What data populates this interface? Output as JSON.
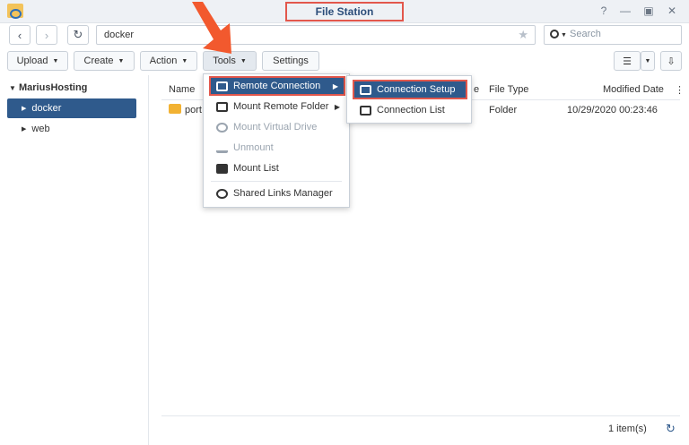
{
  "window": {
    "title": "File Station",
    "help_icon": "question-icon",
    "minimize_icon": "minimize-icon",
    "maximize_icon": "maximize-icon",
    "close_icon": "close-icon"
  },
  "nav": {
    "path": "docker",
    "search_placeholder": "Search"
  },
  "toolbar": {
    "upload": "Upload",
    "create": "Create",
    "action": "Action",
    "tools": "Tools",
    "settings": "Settings"
  },
  "tree": {
    "root": "MariusHosting",
    "items": [
      {
        "label": "docker"
      },
      {
        "label": "web"
      }
    ]
  },
  "table": {
    "headers": {
      "name": "Name",
      "size": "e",
      "type": "File Type",
      "modified": "Modified Date"
    },
    "rows": [
      {
        "name": "port",
        "type": "Folder",
        "modified": "10/29/2020 00:23:46"
      }
    ]
  },
  "status": {
    "count": "1 item(s)"
  },
  "tools_menu": {
    "items": [
      {
        "label": "Remote Connection"
      },
      {
        "label": "Mount Remote Folder"
      },
      {
        "label": "Mount Virtual Drive"
      },
      {
        "label": "Unmount"
      },
      {
        "label": "Mount List"
      },
      {
        "label": "Shared Links Manager"
      }
    ]
  },
  "submenu": {
    "items": [
      {
        "label": "Connection Setup"
      },
      {
        "label": "Connection List"
      }
    ]
  },
  "colors": {
    "accent": "#2f5a8c",
    "highlight_border": "#e2574c",
    "arrow": "#f2592e"
  }
}
